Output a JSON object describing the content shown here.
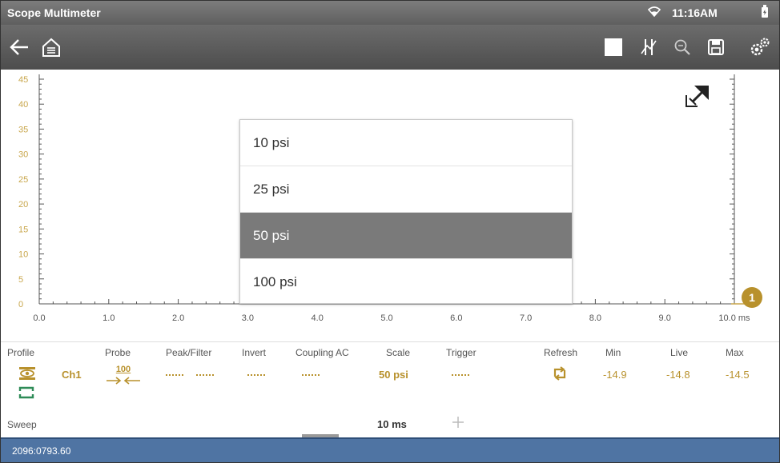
{
  "titlebar": {
    "title": "Scope Multimeter",
    "time": "11:16AM"
  },
  "toolbar": {
    "icons": [
      "back-arrow-icon",
      "home-icon",
      "stop-icon",
      "cursor-icon",
      "zoom-icon",
      "save-icon",
      "settings-icon"
    ]
  },
  "chart_data": {
    "type": "line",
    "y_ticks": [
      "45",
      "40",
      "35",
      "30",
      "25",
      "20",
      "15",
      "10",
      "5",
      "0"
    ],
    "x_ticks": [
      "0.0",
      "1.0",
      "2.0",
      "3.0",
      "4.0",
      "5.0",
      "6.0",
      "7.0",
      "8.0",
      "9.0",
      "10.0 ms"
    ],
    "ylim": [
      0,
      45
    ],
    "xlim": [
      0,
      10
    ],
    "channel_marker": "1",
    "series": []
  },
  "scale_dropdown": {
    "options": [
      "10 psi",
      "25 psi",
      "50 psi",
      "100 psi"
    ],
    "selected_index": 2
  },
  "controls": {
    "headers": {
      "profile": "Profile",
      "probe": "Probe",
      "peak_filter": "Peak/Filter",
      "invert": "Invert",
      "coupling": "Coupling AC",
      "scale": "Scale",
      "trigger": "Trigger",
      "refresh": "Refresh",
      "min": "Min",
      "live": "Live",
      "max": "Max"
    },
    "channel": "Ch1",
    "probe_value": "100",
    "scale_value": "50 psi",
    "min_value": "-14.9",
    "live_value": "-14.8",
    "max_value": "-14.5",
    "sweep_label": "Sweep",
    "sweep_value": "10 ms"
  },
  "status": {
    "text": "2096:0793.60"
  },
  "colors": {
    "accent": "#b8912c",
    "statusbar": "#4f74a3",
    "selected": "#7a7a7a"
  }
}
